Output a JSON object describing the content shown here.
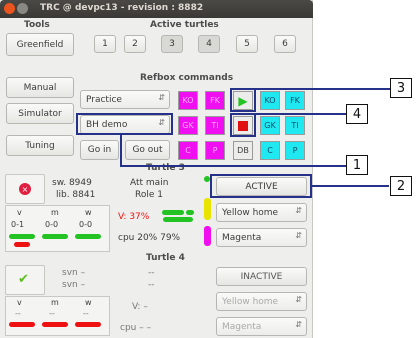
{
  "window": {
    "title": "TRC @ devpc13 - revision : 8882"
  },
  "tools": {
    "header": "Tools",
    "buttons": [
      "Greenfield",
      "Manual",
      "Simulator",
      "Tuning"
    ]
  },
  "active_turtles": {
    "header": "Active turtles",
    "numbers": [
      "1",
      "2",
      "3",
      "4",
      "5",
      "6"
    ]
  },
  "refbox": {
    "header": "Refbox commands",
    "mode_combo": "Practice",
    "demo_combo": "BH demo",
    "go_in": "Go in",
    "go_out": "Go out",
    "grid_row1": [
      "KO",
      "FK",
      "",
      "",
      "KO",
      "FK"
    ],
    "grid_row2": [
      "GK",
      "TI",
      "",
      "",
      "GK",
      "TI"
    ],
    "grid_row3": [
      "C",
      "P",
      "",
      "DB",
      "C",
      "P"
    ],
    "play_icon": "play-icon",
    "stop_icon": "stop-icon"
  },
  "turtle3": {
    "header": "Turtle 3",
    "sw": "sw. 8949",
    "lib": "lib. 8841",
    "att": "Att main",
    "role": "Role 1",
    "vmw_headers": [
      "v",
      "m",
      "w"
    ],
    "vmw_values": [
      "0-1",
      "0-0",
      "0-0"
    ],
    "voltage": "V: 37%",
    "cpu": "cpu  20% 79%",
    "status_button": "ACTIVE",
    "home_combo": "Yellow home",
    "color_combo": "Magenta",
    "colors": {
      "voltage": "#ee1111",
      "bar_green": "#22c322",
      "bar_red": "#ee1111",
      "status_bar": "#e8e400",
      "magenta_bar": "#f00ff0"
    }
  },
  "turtle4": {
    "header": "Turtle 4",
    "sw": "svn –",
    "lib": "svn –",
    "att": "--",
    "role": "--",
    "vmw_headers": [
      "v",
      "m",
      "w"
    ],
    "vmw_values": [
      "--",
      "--",
      "--"
    ],
    "voltage": "V: –",
    "cpu": "cpu  –  –",
    "status_button": "INACTIVE",
    "home_combo": "Yellow home",
    "color_combo": "Magenta"
  },
  "callouts": [
    "1",
    "2",
    "3",
    "4"
  ]
}
